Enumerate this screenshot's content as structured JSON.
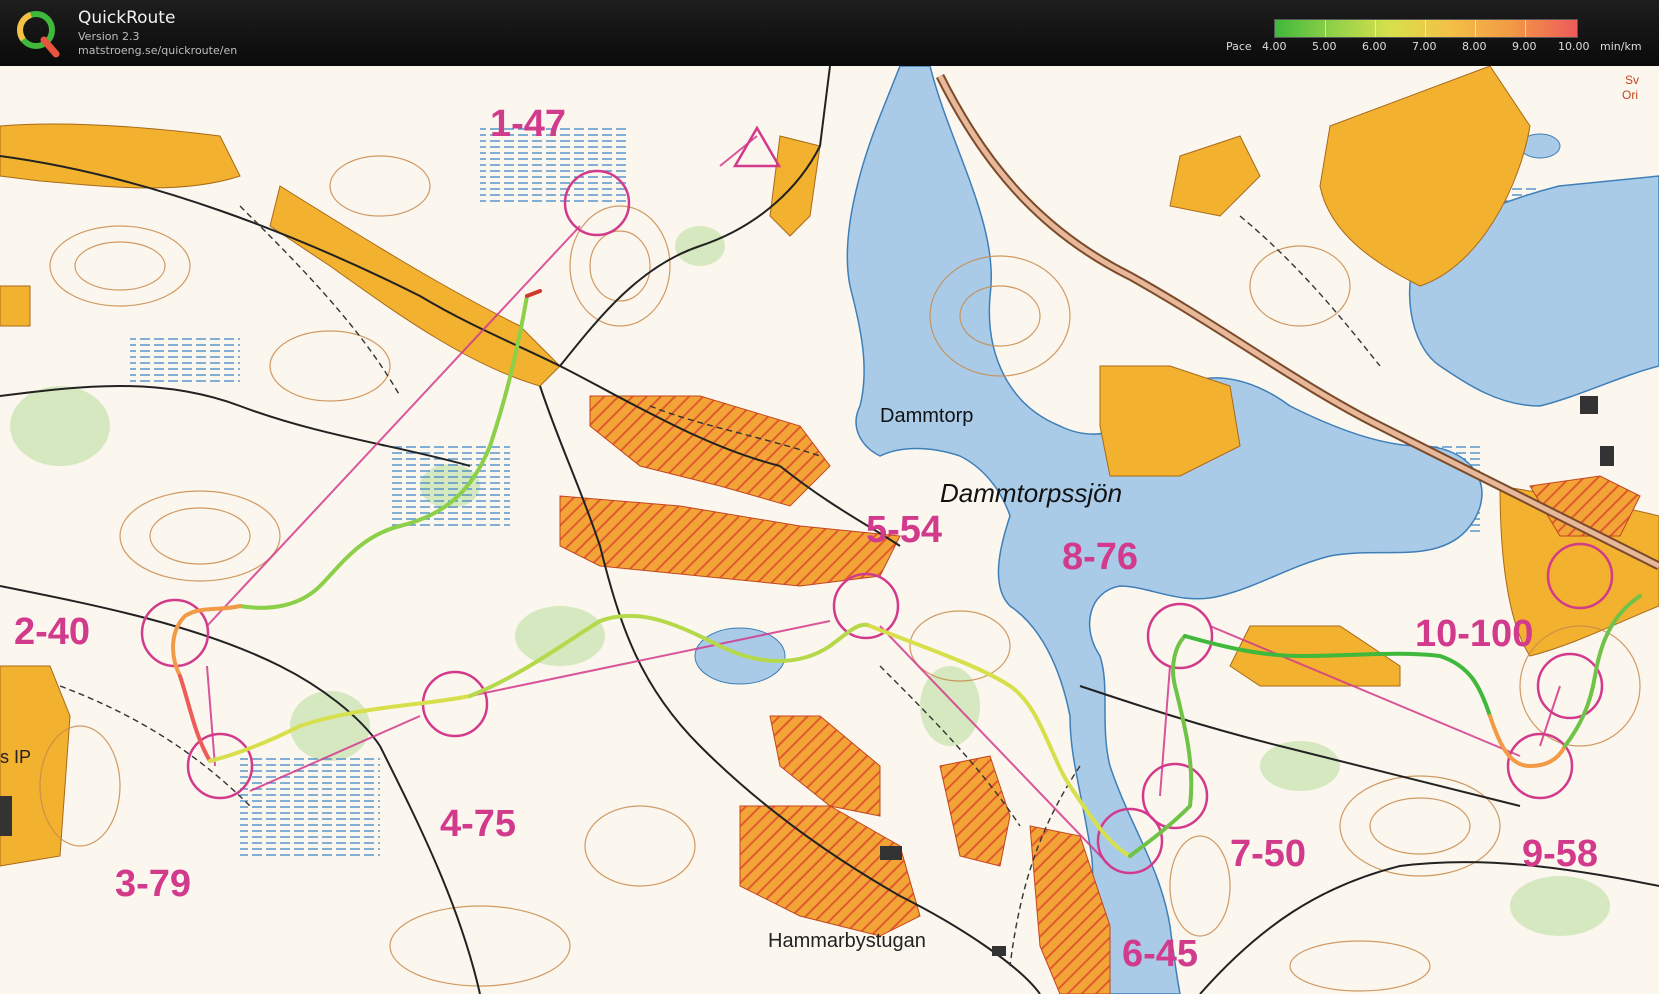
{
  "app": {
    "title": "QuickRoute",
    "version": "Version 2.3",
    "url": "matstroeng.se/quickroute/en"
  },
  "legend": {
    "label": "Pace",
    "ticks": [
      "4.00",
      "5.00",
      "6.00",
      "7.00",
      "8.00",
      "9.00",
      "10.00"
    ],
    "unit": "min/km",
    "colors": [
      "#3fb83c",
      "#8ccf48",
      "#d7e04c",
      "#f4c046",
      "#f29a45",
      "#ee5b5b"
    ]
  },
  "map": {
    "place_names": {
      "dammtorp": "Dammtorp",
      "lake": "Dammtorpssjön",
      "hammarbystugan": "Hammarbystugan",
      "ip": "s IP",
      "edge_top": "Sv",
      "edge_top2": "Ori"
    },
    "controls": [
      {
        "label": "1-47"
      },
      {
        "label": "2-40"
      },
      {
        "label": "3-79"
      },
      {
        "label": "4-75"
      },
      {
        "label": "5-54"
      },
      {
        "label": "6-45"
      },
      {
        "label": "7-50"
      },
      {
        "label": "8-76"
      },
      {
        "label": "9-58"
      },
      {
        "label": "10-100"
      }
    ],
    "colors": {
      "water": "#a9cbe8",
      "field": "#f2b12e",
      "course": "#d23a8c",
      "paper": "#fbf6ee",
      "contour": "#c98a4b"
    }
  }
}
